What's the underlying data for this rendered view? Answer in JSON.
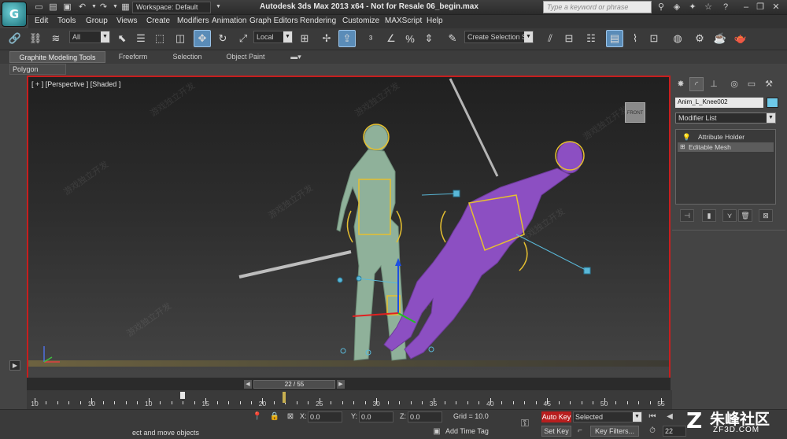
{
  "window": {
    "title": "Autodesk 3ds Max  2013 x64  - Not for Resale   06_begin.max",
    "workspace": "Workspace: Default",
    "search_placeholder": "Type a keyword or phrase",
    "logo_text": "G"
  },
  "menu": [
    "Edit",
    "Tools",
    "Group",
    "Views",
    "Create",
    "Modifiers",
    "Animation",
    "Graph Editors",
    "Rendering",
    "Customize",
    "MAXScript",
    "Help"
  ],
  "toolbar": {
    "filter_select": "All",
    "coord_select": "Local",
    "named_selection_placeholder": "Create Selection Se"
  },
  "ribbon": {
    "tabs": [
      "Graphite Modeling Tools",
      "Freeform",
      "Selection",
      "Object Paint"
    ],
    "active_tab": "Graphite Modeling Tools",
    "panel": "Polygon Modeling"
  },
  "viewport": {
    "label": "[ + ] [Perspective ] [Shaded ]",
    "viewcube_label": "FRONT"
  },
  "command_panel": {
    "object_name": "Anim_L_Knee002",
    "object_color": "#6ec9e8",
    "modifier_list": "Modifier List",
    "stack": [
      "Attribute Holder",
      "Editable Mesh"
    ]
  },
  "timeline": {
    "slider_text": "22 / 55",
    "current_frame": 22,
    "total_frames": 55,
    "keyframes": [
      13,
      22
    ],
    "tick_labels": [
      {
        "frame": 0,
        "label": "10"
      },
      {
        "frame": 5,
        "label": "10"
      },
      {
        "frame": 10,
        "label": "10"
      },
      {
        "frame": 15,
        "label": "15"
      },
      {
        "frame": 20,
        "label": "20"
      },
      {
        "frame": 25,
        "label": "25"
      },
      {
        "frame": 30,
        "label": "30"
      },
      {
        "frame": 35,
        "label": "35"
      },
      {
        "frame": 40,
        "label": "40"
      },
      {
        "frame": 45,
        "label": "45"
      },
      {
        "frame": 50,
        "label": "50"
      },
      {
        "frame": 55,
        "label": "55"
      }
    ]
  },
  "status": {
    "x_label": "X:",
    "x_value": "0.0",
    "y_label": "Y:",
    "y_value": "0.0",
    "z_label": "Z:",
    "z_value": "0.0",
    "grid": "Grid = 10.0",
    "auto_key": "Auto Key",
    "set_key": "Set Key",
    "selected": "Selected",
    "key_filters": "Key Filters...",
    "add_time_tag": "Add Time Tag",
    "prompt": "ect and move objects",
    "frame_field": "22"
  },
  "watermark": {
    "big_text": "朱峰社区",
    "small_text": "ZF3D.COM",
    "overlay_text": "游戏独立开发"
  },
  "colors": {
    "viewport_border": "#c81e1e",
    "auto_key": "#b81e1e",
    "character_green": "#8fb19a",
    "character_purple": "#8c4fc2",
    "rig_yellow": "#e6c030",
    "rig_cyan": "#5ab8d8"
  }
}
